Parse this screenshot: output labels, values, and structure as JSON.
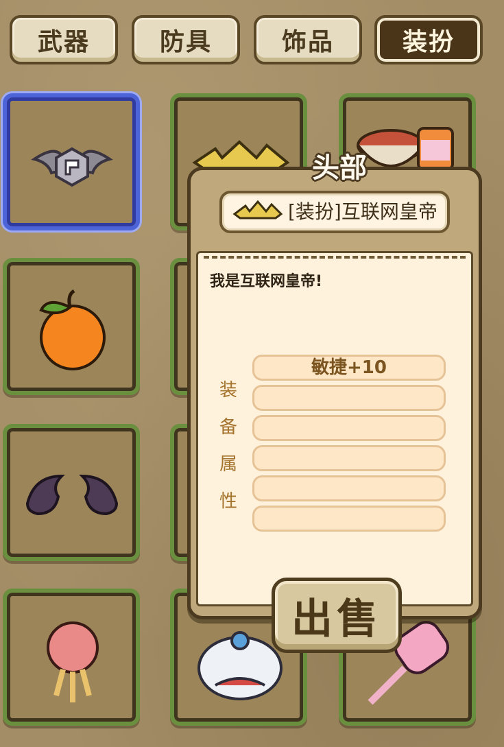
{
  "tabs": [
    {
      "label": "武器",
      "active": false
    },
    {
      "label": "防具",
      "active": false
    },
    {
      "label": "饰品",
      "active": false
    },
    {
      "label": "装扮",
      "active": true
    }
  ],
  "grid": {
    "items": [
      {
        "icon": "bat-wing-emblem-icon",
        "selected": true
      },
      {
        "icon": "golden-crown-icon"
      },
      {
        "icon": "noodle-bowl-drink-icon"
      },
      {
        "icon": "orange-fruit-icon"
      },
      {
        "icon": "hidden-item-icon"
      },
      {
        "icon": "hidden-item-icon"
      },
      {
        "icon": "devil-horns-icon"
      },
      {
        "icon": "hidden-item-icon"
      },
      {
        "icon": "hidden-item-icon"
      },
      {
        "icon": "red-lantern-knot-icon"
      },
      {
        "icon": "lion-dance-head-icon"
      },
      {
        "icon": "pink-heart-wand-icon"
      }
    ]
  },
  "popup": {
    "slot_title": "头部",
    "item_name": "[装扮]互联网皇帝",
    "item_icon": "golden-crown-icon",
    "description": "我是互联网皇帝!",
    "attr_label_chars": [
      "装",
      "备",
      "属",
      "性"
    ],
    "attributes": [
      "敏捷+10",
      "",
      "",
      "",
      "",
      ""
    ],
    "sell_label": "出售"
  },
  "colors": {
    "slot_border": "#6a8f3e",
    "selected_border": "#4d64d8",
    "popup_bg": "#fff2dc"
  }
}
